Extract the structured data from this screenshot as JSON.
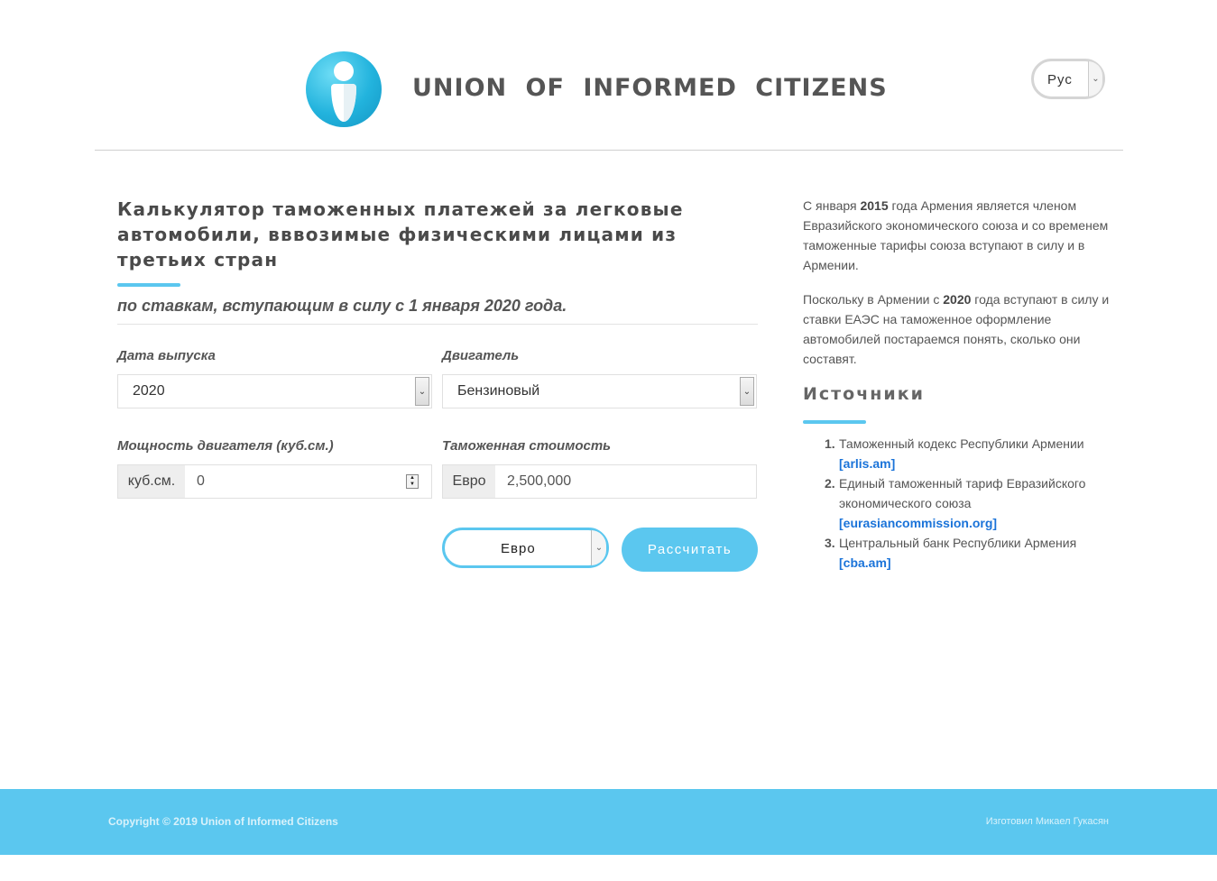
{
  "header": {
    "site_title": "UNION OF INFORMED CITIZENS",
    "language_selector": "Рус",
    "logo_icon": "info-person-icon"
  },
  "calculator": {
    "title": "Калькулятор таможенных платежей за легковые автомобили, вввозимые физическими лицами из третьих стран",
    "subtitle": "по ставкам, вступающим в силу с 1 января 2020 года.",
    "release_date_label": "Дата выпуска",
    "release_date_value": "2020",
    "engine_label": "Двигатель",
    "engine_value": "Бензиновый",
    "engine_power_label": "Мощность двигателя (куб.см.)",
    "engine_power_unit": "куб.см.",
    "engine_power_value": "0",
    "customs_value_label": "Таможенная стоимость",
    "customs_value_currency": "Евро",
    "customs_value_value": "2,500,000",
    "currency_select": "Евро",
    "calculate_button": "Рассчитать"
  },
  "sidebar": {
    "para1": {
      "t1": "С января ",
      "year": "2015",
      "t2": " года Армения является членом Евразийского экономического союза и со временем таможенные тарифы союза вступают в силу и в Армении."
    },
    "para2": {
      "t1": "Поскольку в Армении с ",
      "year": "2020",
      "t2": " года вступают в силу и ставки ЕАЭС на таможенное оформление автомобилей постараемся понять, сколько они составят."
    },
    "sources_title": "Источники",
    "sources": [
      {
        "num": "1.",
        "text": "Таможенный кодекс Республики Армении",
        "link": "[arlis.am]"
      },
      {
        "num": "2.",
        "text": "Единый таможенный тариф Евразийского экономического союза",
        "link": "[eurasiancommission.org]"
      },
      {
        "num": "3.",
        "text": "Центральный банк Республики Армения",
        "link": "[cba.am]"
      }
    ]
  },
  "footer": {
    "copyright": "Copyright © 2019 Union of Informed Citizens",
    "made_by": "Изготовил Микаел Гукасян"
  },
  "colors": {
    "accent": "#5bc7ef",
    "link": "#1a73d9",
    "text": "#555555"
  }
}
